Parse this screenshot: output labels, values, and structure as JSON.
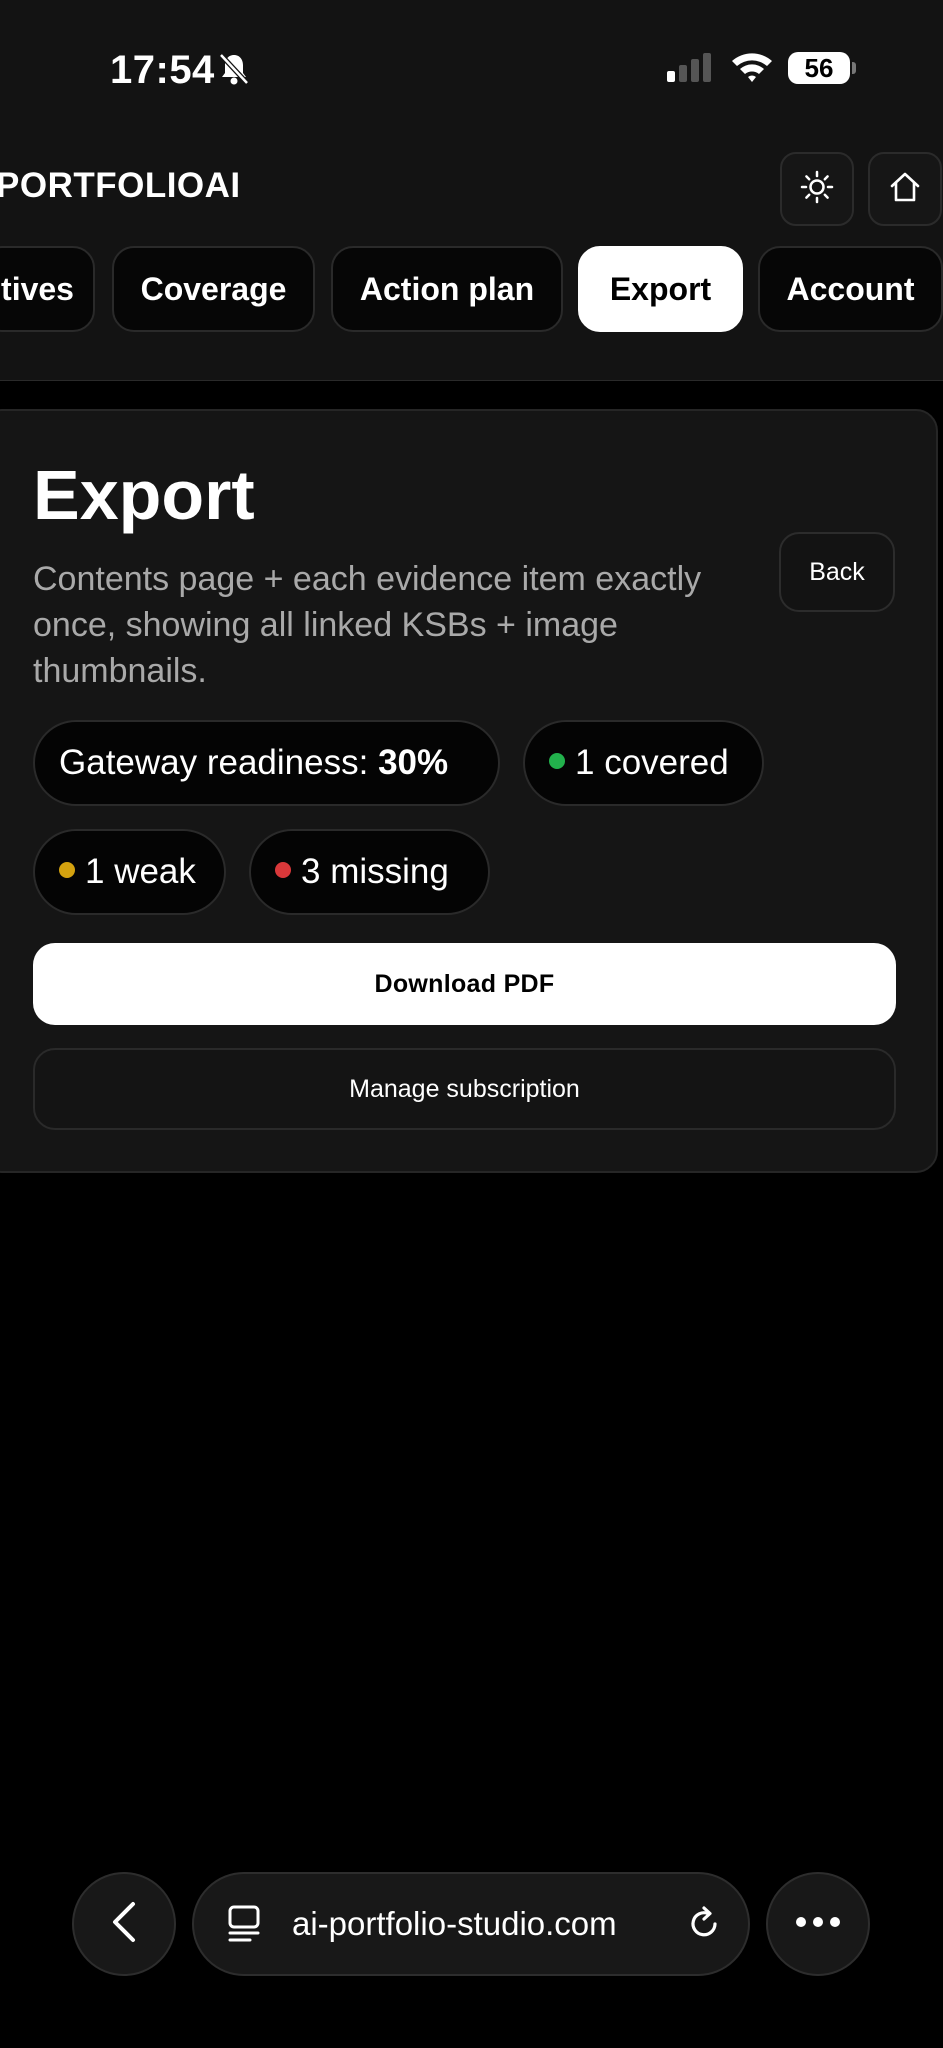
{
  "status_bar": {
    "time": "17:54",
    "battery": "56"
  },
  "header": {
    "brand": "PORTFOLIOAI"
  },
  "tabs": [
    {
      "label": "tives"
    },
    {
      "label": "Coverage"
    },
    {
      "label": "Action plan"
    },
    {
      "label": "Export",
      "active": true
    },
    {
      "label": "Account"
    }
  ],
  "export_card": {
    "title": "Export",
    "description": "Contents page + each evidence item exactly once, showing all linked KSBs + image thumbnails.",
    "back_label": "Back",
    "readiness_label": "Gateway readiness:",
    "readiness_value": "30%",
    "covered": "1 covered",
    "weak": "1 weak",
    "missing": "3 missing",
    "download_label": "Download PDF",
    "subscription_label": "Manage subscription"
  },
  "browser": {
    "url": "ai-portfolio-studio.com"
  },
  "colors": {
    "covered": "#22b14c",
    "weak": "#d4a20f",
    "missing": "#d9383a"
  },
  "icons": [
    "bell-slash-icon",
    "cellular-signal-icon",
    "wifi-icon",
    "battery-icon",
    "sun-icon",
    "home-icon",
    "back-chevron-icon",
    "tabs-icon",
    "reload-icon",
    "more-icon"
  ]
}
